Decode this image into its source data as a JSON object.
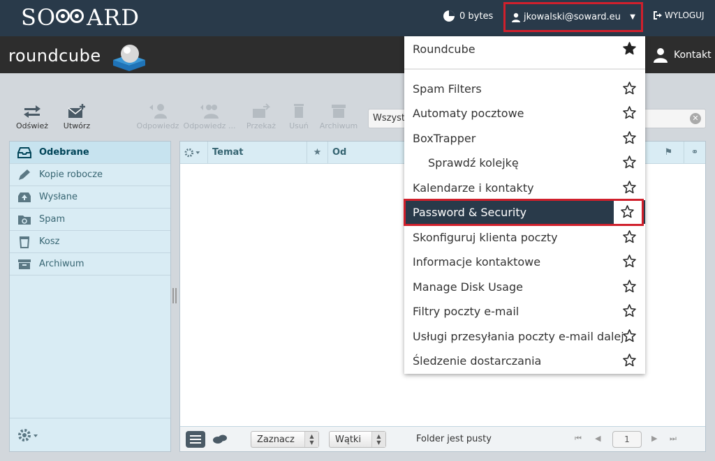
{
  "topbar": {
    "brand": "SO ARD",
    "disk_usage": "0 bytes",
    "user_email": "jkowalski@soward.eu",
    "logout_label": "WYLOGUJ"
  },
  "rcbar": {
    "logo": "roundcube",
    "contacts_label": "Kontakt"
  },
  "toolbar": {
    "buttons": [
      {
        "label": "Odśwież",
        "icon": "refresh-icon",
        "enabled": true
      },
      {
        "label": "Utwórz",
        "icon": "compose-icon",
        "enabled": true
      },
      {
        "label": "Odpowiedz",
        "icon": "reply-icon",
        "enabled": false
      },
      {
        "label": "Odpowiedz ...",
        "icon": "reply-all-icon",
        "enabled": false
      },
      {
        "label": "Przekaż",
        "icon": "forward-icon",
        "enabled": false
      },
      {
        "label": "Usuń",
        "icon": "trash-icon",
        "enabled": false
      },
      {
        "label": "Archiwum",
        "icon": "archive-icon",
        "enabled": false
      }
    ],
    "search_scope": "Wszyst"
  },
  "folders": [
    {
      "label": "Odebrane",
      "icon": "inbox-icon",
      "active": true
    },
    {
      "label": "Kopie robocze",
      "icon": "pencil-icon",
      "active": false
    },
    {
      "label": "Wysłane",
      "icon": "sent-icon",
      "active": false
    },
    {
      "label": "Spam",
      "icon": "spam-icon",
      "active": false
    },
    {
      "label": "Kosz",
      "icon": "trash-icon",
      "active": false
    },
    {
      "label": "Archiwum",
      "icon": "archive-icon",
      "active": false
    }
  ],
  "msglist": {
    "col_subject": "Temat",
    "col_from": "Od",
    "select_label": "Zaznacz",
    "threads_label": "Wątki",
    "status": "Folder jest pusty",
    "page": "1"
  },
  "dropdown": {
    "items": [
      {
        "label": "Roundcube",
        "starred": true,
        "sub": false,
        "highlight": false
      },
      {
        "label": "Spam Filters",
        "starred": false,
        "sub": false,
        "highlight": false
      },
      {
        "label": "Automaty pocztowe",
        "starred": false,
        "sub": false,
        "highlight": false
      },
      {
        "label": "BoxTrapper",
        "starred": false,
        "sub": false,
        "highlight": false
      },
      {
        "label": "Sprawdź kolejkę",
        "starred": false,
        "sub": true,
        "highlight": false
      },
      {
        "label": "Kalendarze i kontakty",
        "starred": false,
        "sub": false,
        "highlight": false
      },
      {
        "label": "Password & Security",
        "starred": false,
        "sub": false,
        "highlight": true
      },
      {
        "label": "Skonfiguruj klienta poczty",
        "starred": false,
        "sub": false,
        "highlight": false
      },
      {
        "label": "Informacje kontaktowe",
        "starred": false,
        "sub": false,
        "highlight": false
      },
      {
        "label": "Manage Disk Usage",
        "starred": false,
        "sub": false,
        "highlight": false
      },
      {
        "label": "Filtry poczty e-mail",
        "starred": false,
        "sub": false,
        "highlight": false
      },
      {
        "label": "Usługi przesyłania poczty e-mail dalej",
        "starred": false,
        "sub": false,
        "highlight": false
      },
      {
        "label": "Śledzenie dostarczania",
        "starred": false,
        "sub": false,
        "highlight": false
      }
    ]
  },
  "colors": {
    "topbar": "#293a4a",
    "rcbar": "#2d2d2d",
    "highlight_border": "#d0202c",
    "folder_bg": "#d9ecf4"
  }
}
